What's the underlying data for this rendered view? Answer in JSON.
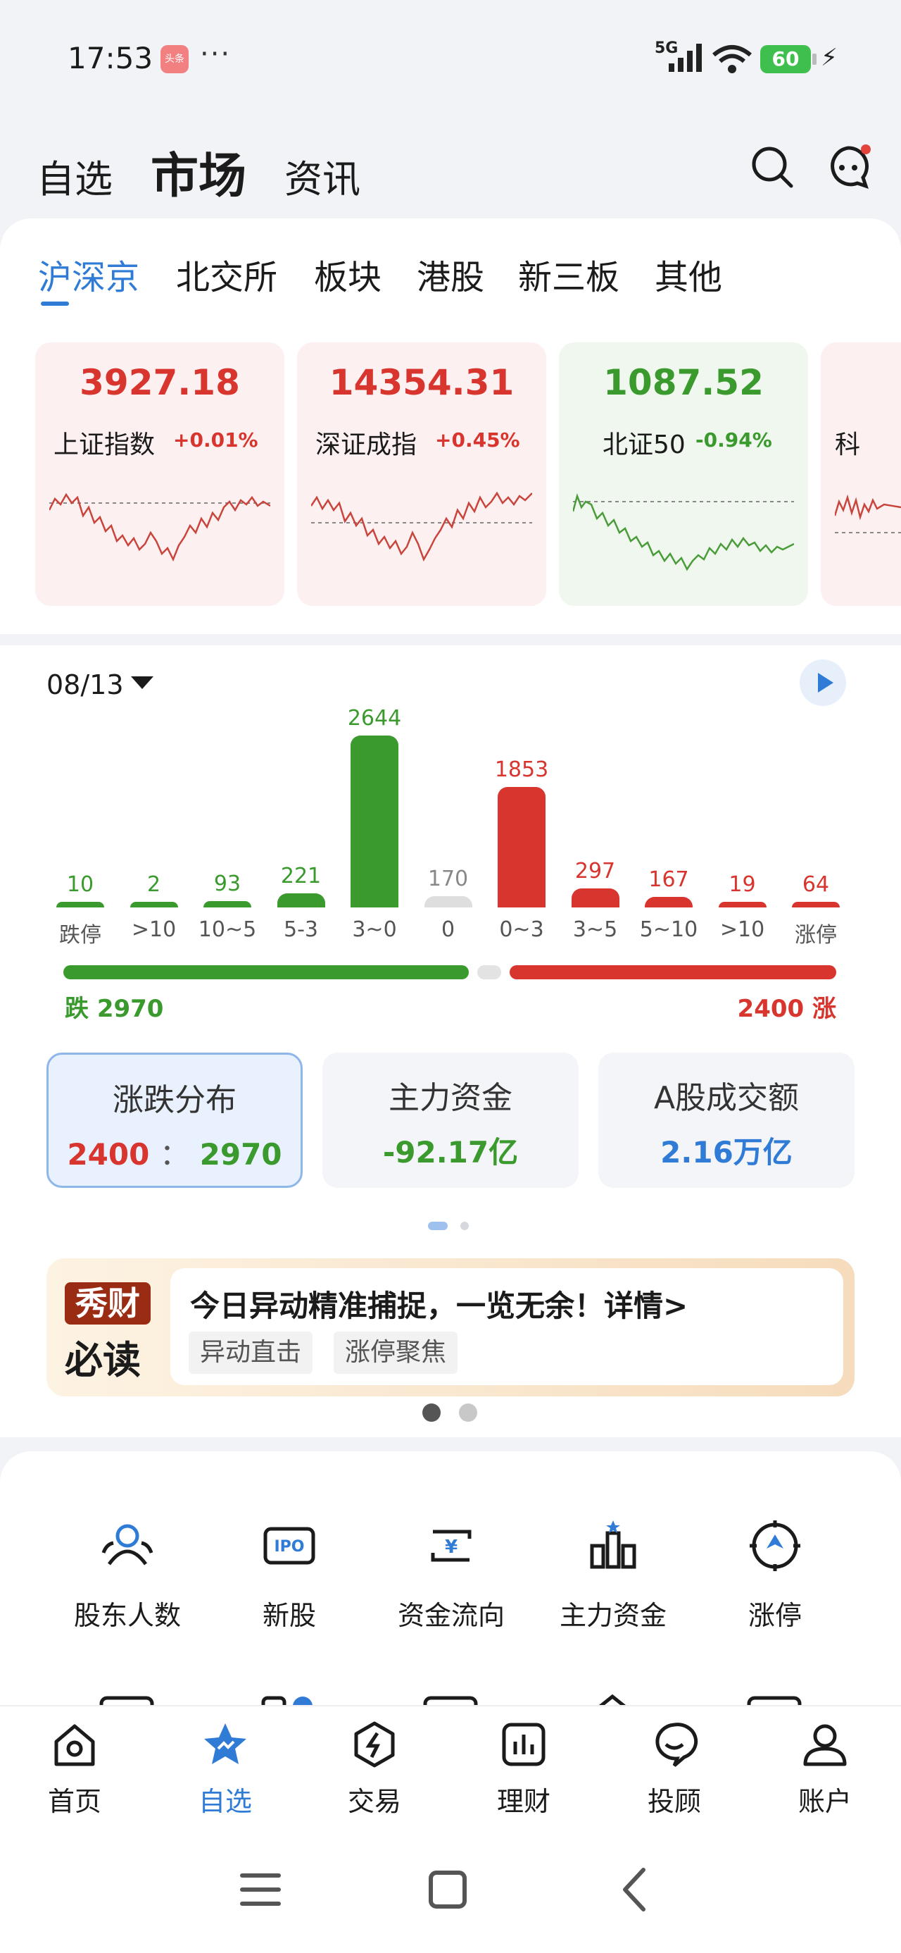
{
  "status": {
    "time": "17:53",
    "app_badge": "头条",
    "dots": "···",
    "network": "5G",
    "battery": "60"
  },
  "header": {
    "tabs": [
      {
        "label": "自选"
      },
      {
        "label": "市场"
      },
      {
        "label": "资讯"
      }
    ],
    "active_tab": "市场"
  },
  "market_tabs": [
    {
      "label": "沪深京"
    },
    {
      "label": "北交所"
    },
    {
      "label": "板块"
    },
    {
      "label": "港股"
    },
    {
      "label": "新三板"
    },
    {
      "label": "其他"
    }
  ],
  "indices": [
    {
      "name": "上证指数",
      "value": "3927.18",
      "change": "+0.01%",
      "trend": "up"
    },
    {
      "name": "深证成指",
      "value": "14354.31",
      "change": "+0.45%",
      "trend": "up"
    },
    {
      "name": "北证50",
      "value": "1087.52",
      "change": "-0.94%",
      "trend": "down"
    },
    {
      "name": "科",
      "value": "",
      "change": "",
      "trend": "up"
    }
  ],
  "distribution": {
    "date": "08/13",
    "down_total_label": "跌 2970",
    "up_total_label": "2400 涨",
    "down_total": 2970,
    "up_total": 2400,
    "bars": [
      {
        "category": "跌停",
        "value": 10,
        "side": "down"
      },
      {
        "category": ">10",
        "value": 2,
        "side": "down"
      },
      {
        "category": "10~5",
        "value": 93,
        "side": "down"
      },
      {
        "category": "5-3",
        "value": 221,
        "side": "down"
      },
      {
        "category": "3~0",
        "value": 2644,
        "side": "down"
      },
      {
        "category": "0",
        "value": 170,
        "side": "flat"
      },
      {
        "category": "0~3",
        "value": 1853,
        "side": "up"
      },
      {
        "category": "3~5",
        "value": 297,
        "side": "up"
      },
      {
        "category": "5~10",
        "value": 167,
        "side": "up"
      },
      {
        "category": ">10",
        "value": 19,
        "side": "up"
      },
      {
        "category": "涨停",
        "value": 64,
        "side": "up"
      }
    ]
  },
  "stats": [
    {
      "title": "涨跌分布",
      "up": "2400",
      "sep": "：",
      "down": "2970"
    },
    {
      "title": "主力资金",
      "value": "-92.17亿"
    },
    {
      "title": "A股成交额",
      "value": "2.16万亿"
    }
  ],
  "banner": {
    "logo_top": "秀财",
    "logo_bottom": "必读",
    "headline": "今日异动精准捕捉，一览无余！详情>",
    "tags": [
      "异动直击",
      "涨停聚焦"
    ]
  },
  "shortcuts": [
    {
      "label": "股东人数",
      "icon": "shareholders-icon"
    },
    {
      "label": "新股",
      "icon": "ipo-icon"
    },
    {
      "label": "资金流向",
      "icon": "capital-flow-icon"
    },
    {
      "label": "主力资金",
      "icon": "main-capital-icon"
    },
    {
      "label": "涨停",
      "icon": "limit-up-icon"
    }
  ],
  "bottom_nav": [
    {
      "label": "首页",
      "icon": "home-icon"
    },
    {
      "label": "自选",
      "icon": "favorites-star-icon"
    },
    {
      "label": "交易",
      "icon": "trade-icon"
    },
    {
      "label": "理财",
      "icon": "wealth-icon"
    },
    {
      "label": "投顾",
      "icon": "advisor-icon"
    },
    {
      "label": "账户",
      "icon": "account-icon"
    }
  ],
  "colors": {
    "up": "#d8352f",
    "down": "#3a9a2d",
    "flat": "#dedede",
    "accent": "#2f7bd6"
  }
}
